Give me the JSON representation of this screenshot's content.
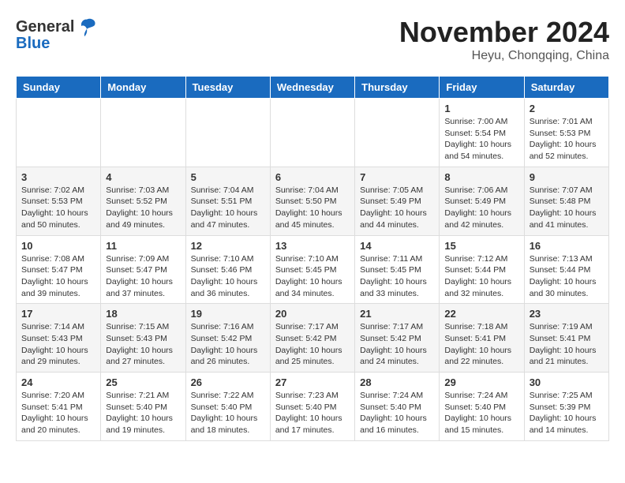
{
  "logo": {
    "general": "General",
    "blue": "Blue"
  },
  "title": {
    "month": "November 2024",
    "location": "Heyu, Chongqing, China"
  },
  "weekdays": [
    "Sunday",
    "Monday",
    "Tuesday",
    "Wednesday",
    "Thursday",
    "Friday",
    "Saturday"
  ],
  "weeks": [
    [
      {
        "day": "",
        "info": ""
      },
      {
        "day": "",
        "info": ""
      },
      {
        "day": "",
        "info": ""
      },
      {
        "day": "",
        "info": ""
      },
      {
        "day": "",
        "info": ""
      },
      {
        "day": "1",
        "info": "Sunrise: 7:00 AM\nSunset: 5:54 PM\nDaylight: 10 hours\nand 54 minutes."
      },
      {
        "day": "2",
        "info": "Sunrise: 7:01 AM\nSunset: 5:53 PM\nDaylight: 10 hours\nand 52 minutes."
      }
    ],
    [
      {
        "day": "3",
        "info": "Sunrise: 7:02 AM\nSunset: 5:53 PM\nDaylight: 10 hours\nand 50 minutes."
      },
      {
        "day": "4",
        "info": "Sunrise: 7:03 AM\nSunset: 5:52 PM\nDaylight: 10 hours\nand 49 minutes."
      },
      {
        "day": "5",
        "info": "Sunrise: 7:04 AM\nSunset: 5:51 PM\nDaylight: 10 hours\nand 47 minutes."
      },
      {
        "day": "6",
        "info": "Sunrise: 7:04 AM\nSunset: 5:50 PM\nDaylight: 10 hours\nand 45 minutes."
      },
      {
        "day": "7",
        "info": "Sunrise: 7:05 AM\nSunset: 5:49 PM\nDaylight: 10 hours\nand 44 minutes."
      },
      {
        "day": "8",
        "info": "Sunrise: 7:06 AM\nSunset: 5:49 PM\nDaylight: 10 hours\nand 42 minutes."
      },
      {
        "day": "9",
        "info": "Sunrise: 7:07 AM\nSunset: 5:48 PM\nDaylight: 10 hours\nand 41 minutes."
      }
    ],
    [
      {
        "day": "10",
        "info": "Sunrise: 7:08 AM\nSunset: 5:47 PM\nDaylight: 10 hours\nand 39 minutes."
      },
      {
        "day": "11",
        "info": "Sunrise: 7:09 AM\nSunset: 5:47 PM\nDaylight: 10 hours\nand 37 minutes."
      },
      {
        "day": "12",
        "info": "Sunrise: 7:10 AM\nSunset: 5:46 PM\nDaylight: 10 hours\nand 36 minutes."
      },
      {
        "day": "13",
        "info": "Sunrise: 7:10 AM\nSunset: 5:45 PM\nDaylight: 10 hours\nand 34 minutes."
      },
      {
        "day": "14",
        "info": "Sunrise: 7:11 AM\nSunset: 5:45 PM\nDaylight: 10 hours\nand 33 minutes."
      },
      {
        "day": "15",
        "info": "Sunrise: 7:12 AM\nSunset: 5:44 PM\nDaylight: 10 hours\nand 32 minutes."
      },
      {
        "day": "16",
        "info": "Sunrise: 7:13 AM\nSunset: 5:44 PM\nDaylight: 10 hours\nand 30 minutes."
      }
    ],
    [
      {
        "day": "17",
        "info": "Sunrise: 7:14 AM\nSunset: 5:43 PM\nDaylight: 10 hours\nand 29 minutes."
      },
      {
        "day": "18",
        "info": "Sunrise: 7:15 AM\nSunset: 5:43 PM\nDaylight: 10 hours\nand 27 minutes."
      },
      {
        "day": "19",
        "info": "Sunrise: 7:16 AM\nSunset: 5:42 PM\nDaylight: 10 hours\nand 26 minutes."
      },
      {
        "day": "20",
        "info": "Sunrise: 7:17 AM\nSunset: 5:42 PM\nDaylight: 10 hours\nand 25 minutes."
      },
      {
        "day": "21",
        "info": "Sunrise: 7:17 AM\nSunset: 5:42 PM\nDaylight: 10 hours\nand 24 minutes."
      },
      {
        "day": "22",
        "info": "Sunrise: 7:18 AM\nSunset: 5:41 PM\nDaylight: 10 hours\nand 22 minutes."
      },
      {
        "day": "23",
        "info": "Sunrise: 7:19 AM\nSunset: 5:41 PM\nDaylight: 10 hours\nand 21 minutes."
      }
    ],
    [
      {
        "day": "24",
        "info": "Sunrise: 7:20 AM\nSunset: 5:41 PM\nDaylight: 10 hours\nand 20 minutes."
      },
      {
        "day": "25",
        "info": "Sunrise: 7:21 AM\nSunset: 5:40 PM\nDaylight: 10 hours\nand 19 minutes."
      },
      {
        "day": "26",
        "info": "Sunrise: 7:22 AM\nSunset: 5:40 PM\nDaylight: 10 hours\nand 18 minutes."
      },
      {
        "day": "27",
        "info": "Sunrise: 7:23 AM\nSunset: 5:40 PM\nDaylight: 10 hours\nand 17 minutes."
      },
      {
        "day": "28",
        "info": "Sunrise: 7:24 AM\nSunset: 5:40 PM\nDaylight: 10 hours\nand 16 minutes."
      },
      {
        "day": "29",
        "info": "Sunrise: 7:24 AM\nSunset: 5:40 PM\nDaylight: 10 hours\nand 15 minutes."
      },
      {
        "day": "30",
        "info": "Sunrise: 7:25 AM\nSunset: 5:39 PM\nDaylight: 10 hours\nand 14 minutes."
      }
    ]
  ]
}
